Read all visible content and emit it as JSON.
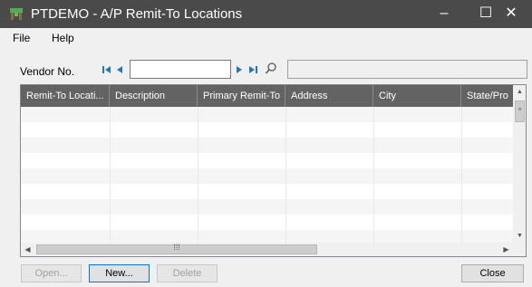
{
  "window": {
    "title": "PTDEMO - A/P Remit-To Locations",
    "minimize_glyph": "–",
    "maximize_glyph": "☐",
    "close_glyph": "✕",
    "titlebar_color": "#4a4a4a",
    "icon": "app-tree-icon"
  },
  "menu": {
    "file_label": "File",
    "help_label": "Help"
  },
  "vendor": {
    "label": "Vendor No.",
    "value": "",
    "name_value": ""
  },
  "grid": {
    "columns": [
      "Remit-To Locati...",
      "Description",
      "Primary Remit-To",
      "Address",
      "City",
      "State/Pro"
    ],
    "rows": [],
    "header_color": "#636363"
  },
  "scrollbars": {
    "h_thumb_grip": "⁞⁞⁞"
  },
  "buttons": {
    "open_label": "Open...",
    "new_label": "New...",
    "delete_label": "Delete",
    "close_label": "Close"
  }
}
